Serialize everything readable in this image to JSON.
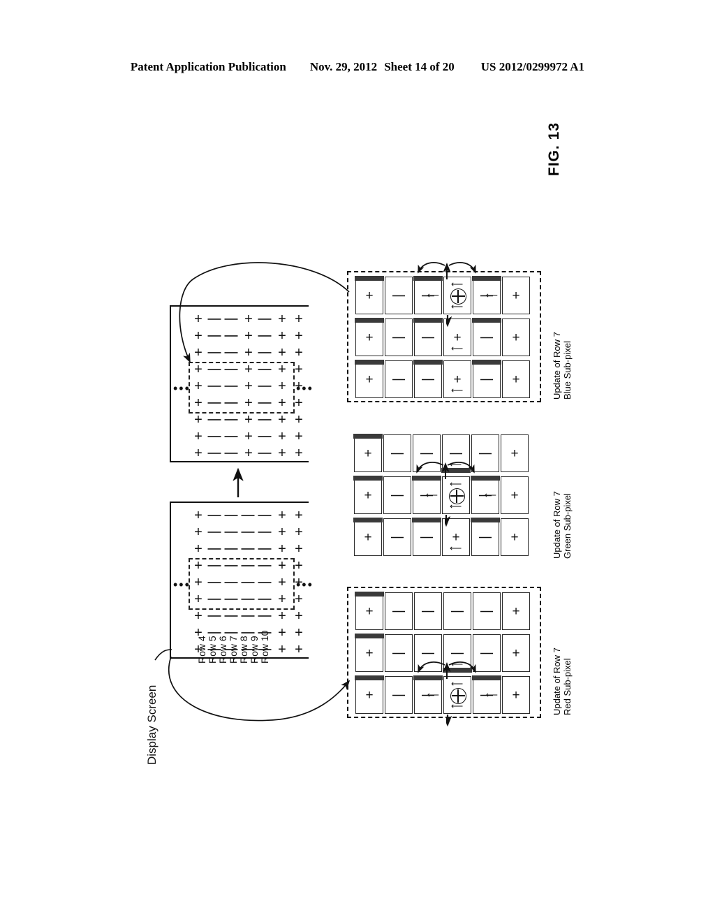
{
  "header": {
    "publication": "Patent Application Publication",
    "date": "Nov. 29, 2012",
    "sheet": "Sheet 14 of 20",
    "number": "US 2012/0299972 A1"
  },
  "figure": {
    "label": "FIG. 13"
  },
  "display_screen": {
    "caption": "Display Screen",
    "row_labels": [
      "Row 4",
      "Row 5",
      "Row 6",
      "Row 7",
      "Row 8",
      "Row 9",
      "Row 10"
    ],
    "ellipsis_left": "•••",
    "ellipsis_right": "•••",
    "grids": [
      {
        "name": "after-update-grid",
        "rows": 9,
        "cols": 7,
        "pattern": [
          "+",
          "|",
          "|",
          "+",
          "|",
          "+",
          "+"
        ]
      },
      {
        "name": "before-update-grid",
        "rows": 9,
        "cols": 7,
        "pattern": [
          "+",
          "|",
          "|",
          "|",
          "|",
          "+",
          "+"
        ]
      }
    ]
  },
  "panels": [
    {
      "id": "blue",
      "label_line1": "Update of Row 7",
      "label_line2": "Blue Sub-pixel",
      "dashed_outline": true,
      "strips": [
        {
          "active": true,
          "cells": [
            {
              "sym": "+",
              "bar": "top",
              "arrows": []
            },
            {
              "sym": "|",
              "bar": "none",
              "arrows": []
            },
            {
              "sym": "|",
              "bar": "top",
              "arrows": [
                "right"
              ]
            },
            {
              "sym": "circle-plus",
              "bar": "none",
              "arrows": [
                "above",
                "below"
              ]
            },
            {
              "sym": "|",
              "bar": "top",
              "arrows": [
                "right"
              ]
            },
            {
              "sym": "+",
              "bar": "none",
              "arrows": []
            }
          ]
        },
        {
          "active": false,
          "cells": [
            {
              "sym": "+",
              "bar": "top",
              "arrows": []
            },
            {
              "sym": "|",
              "bar": "none",
              "arrows": []
            },
            {
              "sym": "|",
              "bar": "top",
              "arrows": []
            },
            {
              "sym": "+",
              "bar": "none",
              "arrows": [
                "below"
              ]
            },
            {
              "sym": "|",
              "bar": "top",
              "arrows": []
            },
            {
              "sym": "+",
              "bar": "none",
              "arrows": []
            }
          ]
        },
        {
          "active": false,
          "cells": [
            {
              "sym": "+",
              "bar": "top",
              "arrows": []
            },
            {
              "sym": "|",
              "bar": "none",
              "arrows": []
            },
            {
              "sym": "|",
              "bar": "top",
              "arrows": []
            },
            {
              "sym": "+",
              "bar": "none",
              "arrows": [
                "below"
              ]
            },
            {
              "sym": "|",
              "bar": "top",
              "arrows": []
            },
            {
              "sym": "+",
              "bar": "none",
              "arrows": []
            }
          ]
        }
      ]
    },
    {
      "id": "green",
      "label_line1": "Update of Row 7",
      "label_line2": "Green Sub-pixel",
      "dashed_outline": false,
      "strips": [
        {
          "active": false,
          "cells": [
            {
              "sym": "+",
              "bar": "top",
              "arrows": []
            },
            {
              "sym": "|",
              "bar": "none",
              "arrows": []
            },
            {
              "sym": "|",
              "bar": "none",
              "arrows": []
            },
            {
              "sym": "|",
              "bar": "bottom",
              "arrows": [
                "below"
              ]
            },
            {
              "sym": "|",
              "bar": "none",
              "arrows": []
            },
            {
              "sym": "+",
              "bar": "none",
              "arrows": []
            }
          ]
        },
        {
          "active": true,
          "cells": [
            {
              "sym": "+",
              "bar": "top",
              "arrows": []
            },
            {
              "sym": "|",
              "bar": "none",
              "arrows": []
            },
            {
              "sym": "|",
              "bar": "top",
              "arrows": [
                "right"
              ]
            },
            {
              "sym": "circle-plus",
              "bar": "none",
              "arrows": [
                "above",
                "below"
              ]
            },
            {
              "sym": "|",
              "bar": "top",
              "arrows": [
                "right"
              ]
            },
            {
              "sym": "+",
              "bar": "none",
              "arrows": []
            }
          ]
        },
        {
          "active": false,
          "cells": [
            {
              "sym": "+",
              "bar": "top",
              "arrows": []
            },
            {
              "sym": "|",
              "bar": "none",
              "arrows": []
            },
            {
              "sym": "|",
              "bar": "top",
              "arrows": []
            },
            {
              "sym": "+",
              "bar": "none",
              "arrows": [
                "below"
              ]
            },
            {
              "sym": "|",
              "bar": "top",
              "arrows": []
            },
            {
              "sym": "+",
              "bar": "none",
              "arrows": []
            }
          ]
        }
      ]
    },
    {
      "id": "red",
      "label_line1": "Update of Row 7",
      "label_line2": "Red Sub-pixel",
      "dashed_outline": true,
      "strips": [
        {
          "active": false,
          "cells": [
            {
              "sym": "+",
              "bar": "top",
              "arrows": []
            },
            {
              "sym": "|",
              "bar": "none",
              "arrows": []
            },
            {
              "sym": "|",
              "bar": "none",
              "arrows": []
            },
            {
              "sym": "|",
              "bar": "none",
              "arrows": []
            },
            {
              "sym": "|",
              "bar": "none",
              "arrows": []
            },
            {
              "sym": "+",
              "bar": "none",
              "arrows": []
            }
          ]
        },
        {
          "active": false,
          "cells": [
            {
              "sym": "+",
              "bar": "top",
              "arrows": []
            },
            {
              "sym": "|",
              "bar": "none",
              "arrows": []
            },
            {
              "sym": "|",
              "bar": "none",
              "arrows": []
            },
            {
              "sym": "|",
              "bar": "bottom",
              "arrows": [
                "below"
              ]
            },
            {
              "sym": "|",
              "bar": "none",
              "arrows": []
            },
            {
              "sym": "+",
              "bar": "none",
              "arrows": []
            }
          ]
        },
        {
          "active": true,
          "cells": [
            {
              "sym": "+",
              "bar": "top",
              "arrows": []
            },
            {
              "sym": "|",
              "bar": "none",
              "arrows": []
            },
            {
              "sym": "|",
              "bar": "top",
              "arrows": [
                "right"
              ]
            },
            {
              "sym": "circle-plus",
              "bar": "none",
              "arrows": [
                "above",
                "below"
              ]
            },
            {
              "sym": "|",
              "bar": "top",
              "arrows": [
                "right"
              ]
            },
            {
              "sym": "+",
              "bar": "none",
              "arrows": []
            }
          ]
        }
      ]
    }
  ],
  "colors": {
    "ink": "#111111",
    "bar": "#3a3a3a",
    "paper": "#ffffff"
  }
}
